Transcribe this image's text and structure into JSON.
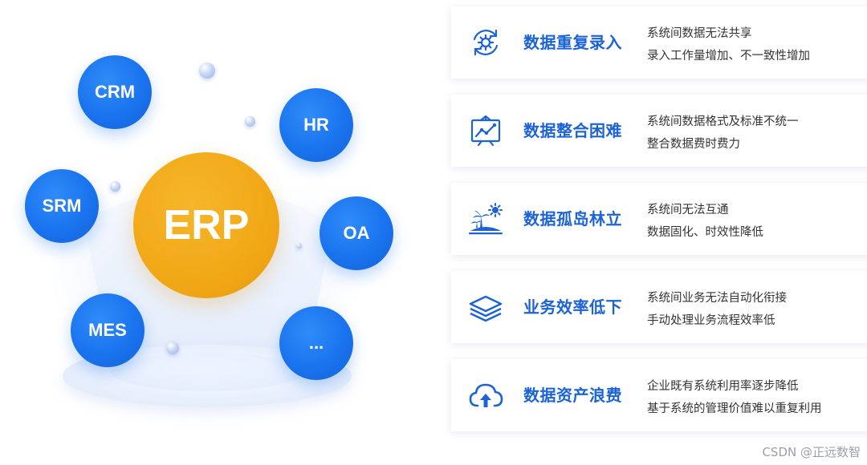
{
  "diagram": {
    "center_label": "ERP",
    "nodes": [
      {
        "id": "crm",
        "label": "CRM"
      },
      {
        "id": "hr",
        "label": "HR"
      },
      {
        "id": "srm",
        "label": "SRM"
      },
      {
        "id": "oa",
        "label": "OA"
      },
      {
        "id": "mes",
        "label": "MES"
      },
      {
        "id": "more",
        "label": "..."
      }
    ],
    "colors": {
      "center": "#F1A817",
      "node": "#1A73EE"
    }
  },
  "problems": [
    {
      "icon": "gear-cycle-icon",
      "title": "数据重复录入",
      "lines": [
        "系统间数据无法共享",
        "录入工作量增加、不一致性增加"
      ]
    },
    {
      "icon": "chart-board-icon",
      "title": "数据整合困难",
      "lines": [
        "系统间数据格式及标准不统一",
        "整合数据费时费力"
      ]
    },
    {
      "icon": "island-icon",
      "title": "数据孤岛林立",
      "lines": [
        "系统间无法互通",
        "数据固化、时效性降低"
      ]
    },
    {
      "icon": "layers-icon",
      "title": "业务效率低下",
      "lines": [
        "系统间业务无法自动化衔接",
        "手动处理业务流程效率低"
      ]
    },
    {
      "icon": "cloud-upload-icon",
      "title": "数据资产浪费",
      "lines": [
        "企业既有系统利用率逐步降低",
        "基于系统的管理价值难以重复利用"
      ]
    }
  ],
  "accent_color": "#1B63D6",
  "watermark": "CSDN @正远数智"
}
